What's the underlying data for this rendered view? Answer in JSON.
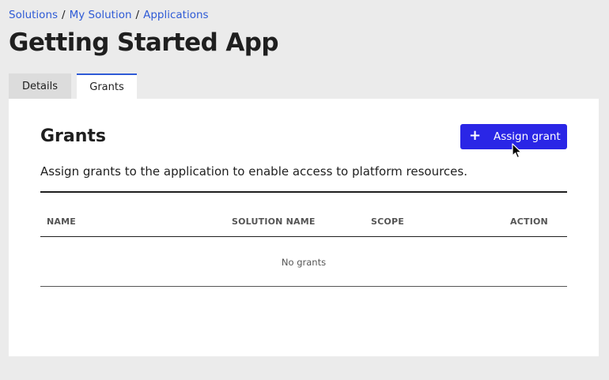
{
  "breadcrumb": {
    "items": [
      "Solutions",
      "My Solution",
      "Applications"
    ],
    "separator": "/"
  },
  "page_title": "Getting Started App",
  "tabs": [
    {
      "label": "Details",
      "active": false
    },
    {
      "label": "Grants",
      "active": true
    }
  ],
  "grants": {
    "title": "Grants",
    "assign_button_label": "Assign grant",
    "description": "Assign grants to the application to enable access to platform resources.",
    "table": {
      "columns": [
        "NAME",
        "SOLUTION NAME",
        "SCOPE",
        "ACTION"
      ],
      "empty_text": "No grants"
    }
  },
  "colors": {
    "accent": "#2f5bd6",
    "primary_button": "#2a26e6",
    "background": "#ebebeb"
  },
  "icons": {
    "add": "plus-icon",
    "cursor": "mouse-pointer-icon"
  }
}
